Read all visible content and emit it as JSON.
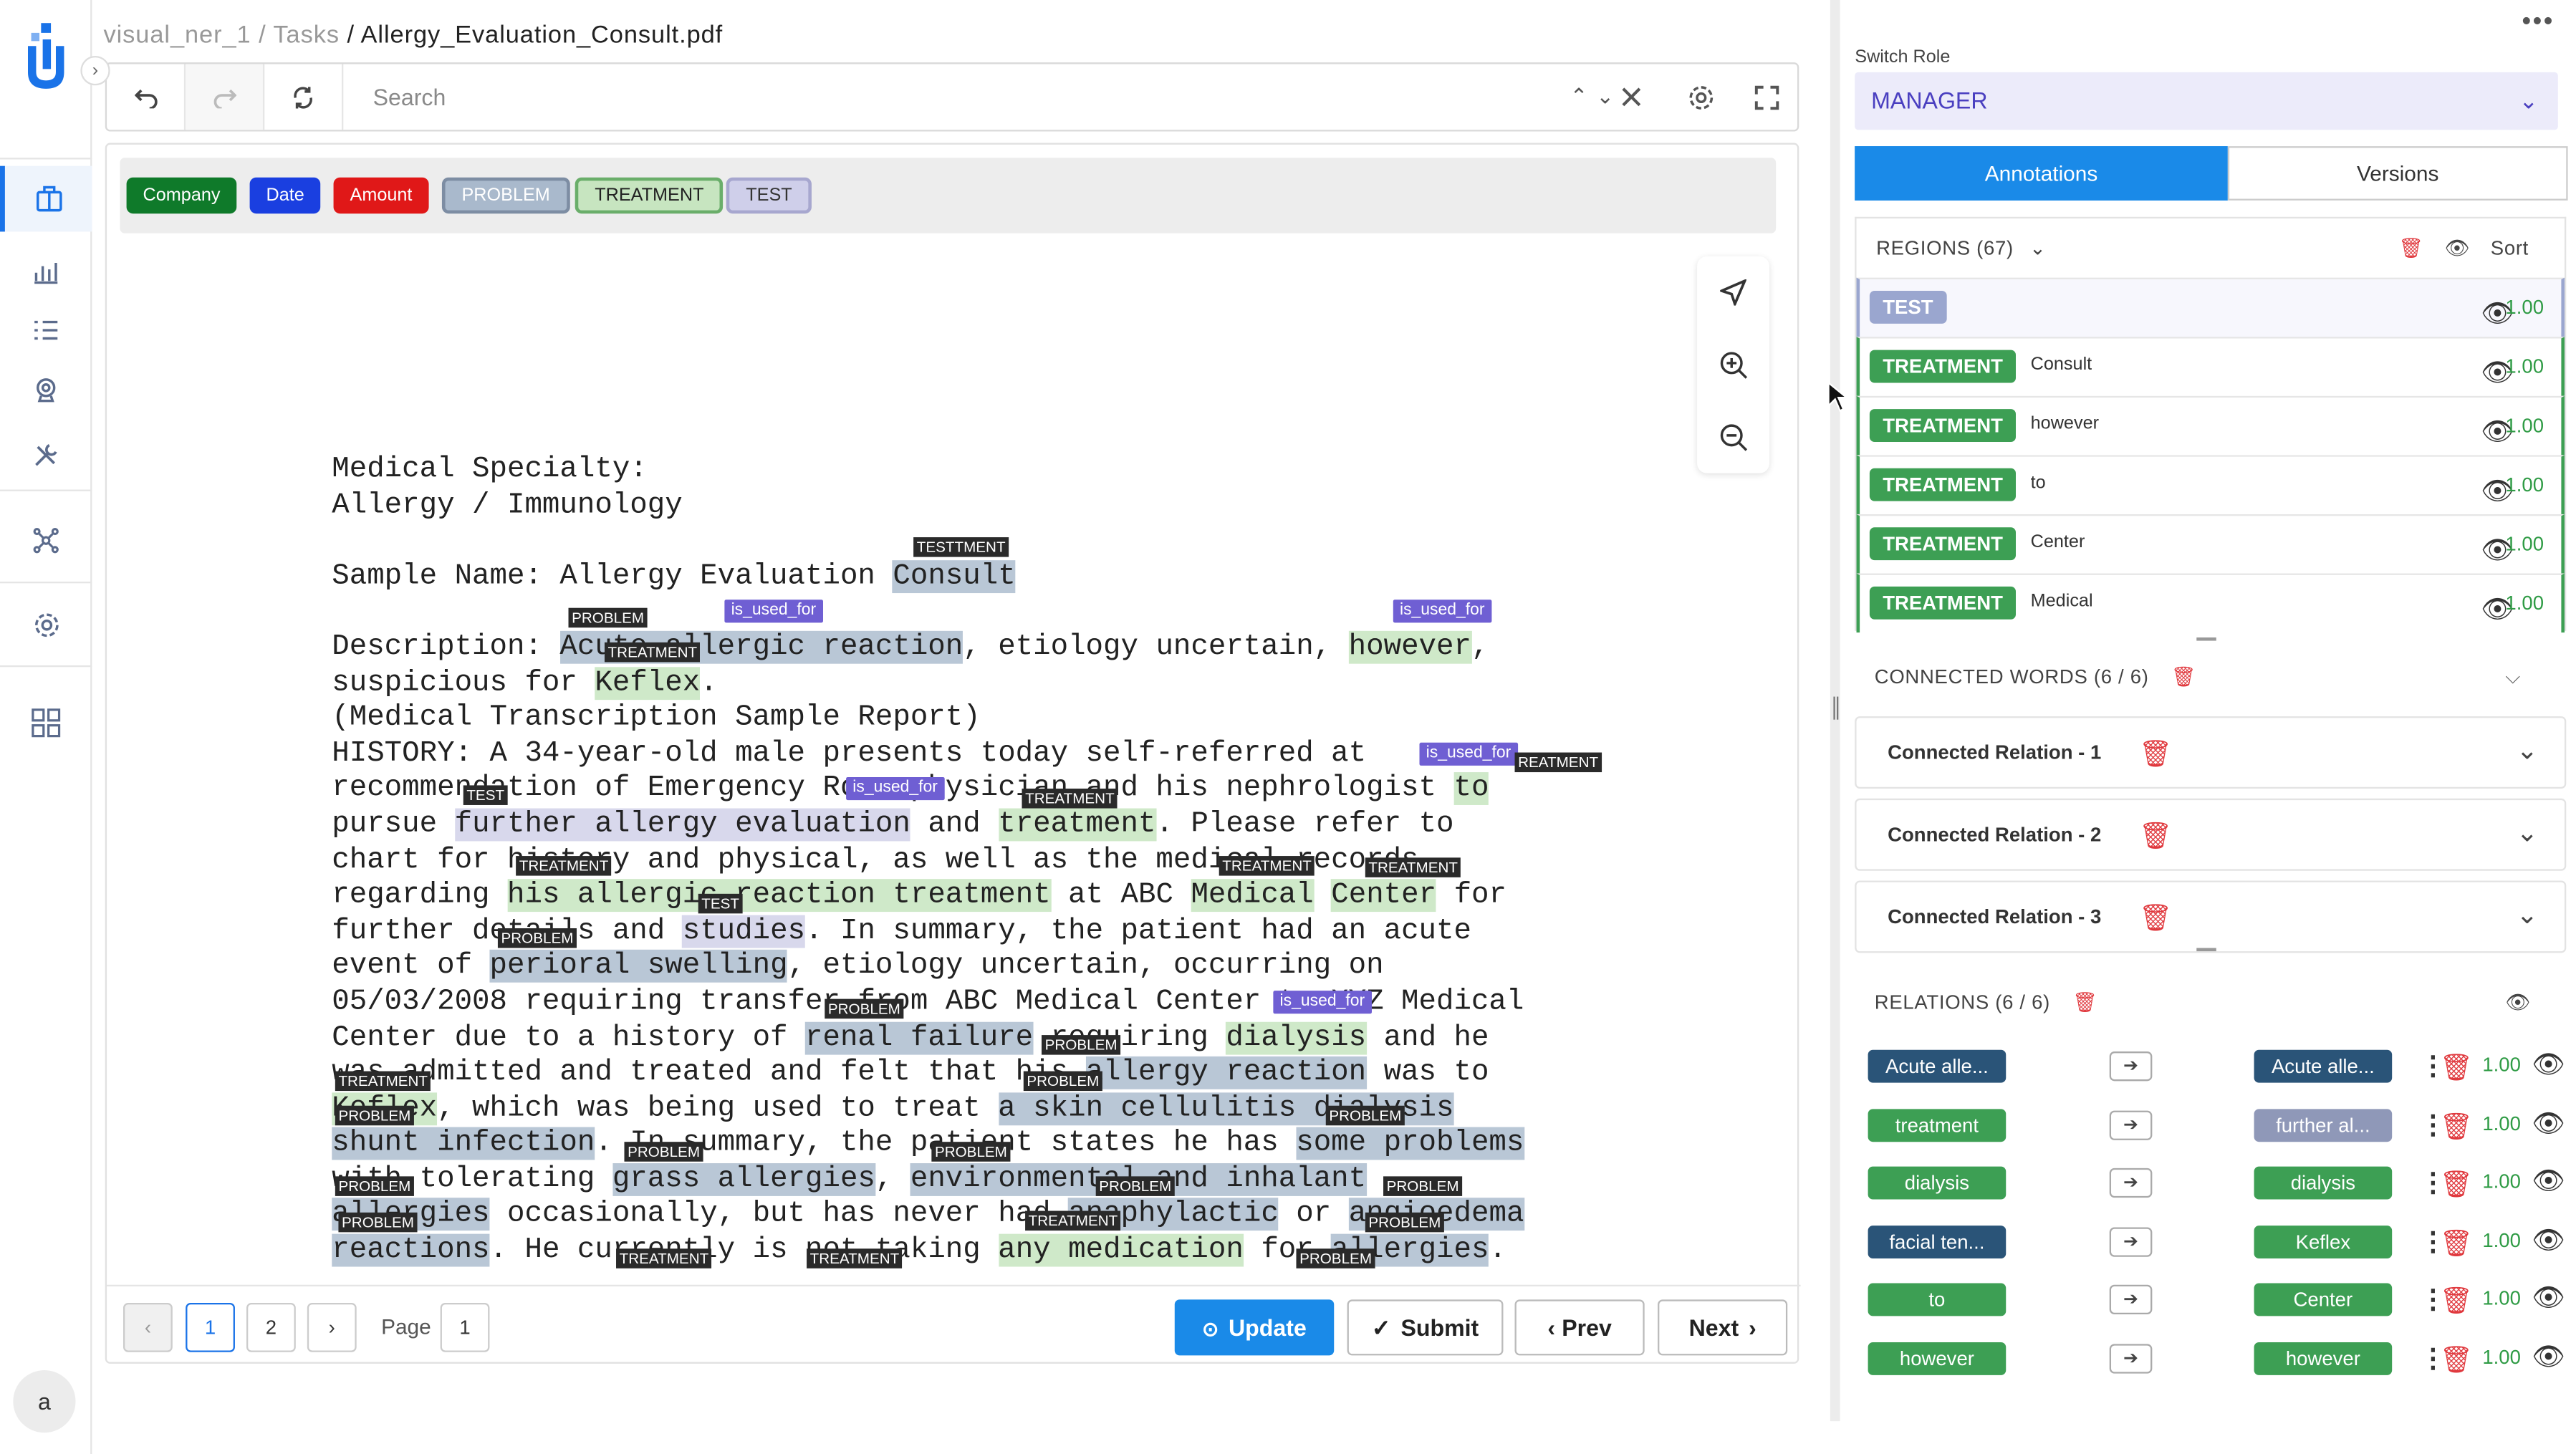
{
  "app": {
    "breadcrumb": {
      "project": "visual_ner_1",
      "sep1": "/",
      "section": "Tasks",
      "sep2": "/",
      "file": "Allergy_Evaluation_Consult.pdf"
    },
    "avatar_initial": "a"
  },
  "toolbar": {
    "search_placeholder": "Search"
  },
  "labels": [
    {
      "text": "Company",
      "bg": "#0f7a2a",
      "fg": "#ffffff"
    },
    {
      "text": "Date",
      "bg": "#1a3fe0",
      "fg": "#ffffff"
    },
    {
      "text": "Amount",
      "bg": "#e01818",
      "fg": "#ffffff"
    },
    {
      "text": "PROBLEM",
      "bg": "#a9b9cc",
      "fg": "#ffffff"
    },
    {
      "text": "TREATMENT",
      "bg": "#c7e5c0",
      "fg": "#222222"
    },
    {
      "text": "TEST",
      "bg": "#cfcfea",
      "fg": "#333333"
    }
  ],
  "doc": {
    "l1": "Medical Specialty:",
    "l2": "Allergy / Immunology",
    "l4a": "Sample Name: Allergy Evaluation ",
    "l4b": "Consult",
    "l6a": "Description: ",
    "l6b": "Acute allergic reaction",
    "l6c": ", etiology uncertain, ",
    "l6d": "however",
    "l6e": ",",
    "l7a": "suspicious for ",
    "l7b": "Keflex",
    "l7c": ".",
    "l8": "(Medical Transcription Sample Report)",
    "l9": "HISTORY: A 34-year-old male presents today self-referred at",
    "l10a": "recommendation of Emergency Room physician and his nephrologist ",
    "l10b": "to",
    "l11a": "pursue ",
    "l11b": "further allergy evaluation",
    "l11c": " and ",
    "l11d": "treatment",
    "l11e": ". Please refer to",
    "l12": "chart for history and physical, as well as the medical records",
    "l13a": "regarding ",
    "l13b": "his allergic reaction treatment",
    "l13c": " at ABC ",
    "l13d": "Medical",
    "l13e": " ",
    "l13f": "Center",
    "l13g": " for",
    "l14a": "further details and ",
    "l14b": "studies",
    "l14c": ". In summary, the patient had an acute",
    "l15a": "event of ",
    "l15b": "perioral swelling",
    "l15c": ", etiology uncertain, occurring on",
    "l16": "05/03/2008 requiring transfer from ABC Medical Center to XYZ Medical",
    "l17a": "Center due to a history of ",
    "l17b": "renal failure",
    "l17c": " requiring ",
    "l17d": "dialysis",
    "l17e": " and he",
    "l18a": "was admitted and treated and felt that his ",
    "l18b": "allergy reaction",
    "l18c": " was to",
    "l19a": "Keflex",
    "l19b": ", which was being used to treat ",
    "l19c": "a skin cellulitis dialysis",
    "l20a": "shunt infection",
    "l20b": ". In summary, the patient states he has ",
    "l20c": "some problems",
    "l21a": "with tolerating ",
    "l21b": "grass allergies",
    "l21c": ", ",
    "l21d": "environmental and inhalant",
    "l22a": "allergies",
    "l22b": " occasionally, but has never had ",
    "l22c": "anaphylactic",
    "l22d": " or ",
    "l22e": "angioedema",
    "l23a": "reactions",
    "l23b": ". He currently is not taking ",
    "l23c": "any medication",
    "l23d": " for ",
    "l23e": "allergies",
    "l23f": "."
  },
  "doc_tags": {
    "test_tment": "TESTTMENT",
    "problem": "PROBLEM",
    "treatment": "TREATMENT",
    "test": "TEST",
    "reatment": "REATMENT",
    "is_used_for": "is_used_for"
  },
  "pager": {
    "prev_page": "‹",
    "page1": "1",
    "page2": "2",
    "next_page": "›",
    "page_label": "Page",
    "page_value": "1",
    "update": "Update",
    "submit": "Submit",
    "prev": "Prev",
    "next": "Next"
  },
  "right": {
    "switch_role_label": "Switch Role",
    "role_value": "MANAGER",
    "tab_annotations": "Annotations",
    "tab_versions": "Versions",
    "regions_title": "REGIONS (67)",
    "sort_label": "Sort",
    "regions": [
      {
        "label": "TEST",
        "text": "",
        "score": "1.00",
        "color": "#9aa6cf"
      },
      {
        "label": "TREATMENT",
        "text": "Consult",
        "score": "1.00",
        "color": "#3d9f54"
      },
      {
        "label": "TREATMENT",
        "text": "however",
        "score": "1.00",
        "color": "#3d9f54"
      },
      {
        "label": "TREATMENT",
        "text": "to",
        "score": "1.00",
        "color": "#3d9f54"
      },
      {
        "label": "TREATMENT",
        "text": "Center",
        "score": "1.00",
        "color": "#3d9f54"
      },
      {
        "label": "TREATMENT",
        "text": "Medical",
        "score": "1.00",
        "color": "#3d9f54"
      }
    ],
    "connected_title": "CONNECTED WORDS (6 / 6)",
    "connected": [
      "Connected Relation - 1",
      "Connected Relation - 2",
      "Connected Relation - 3"
    ],
    "relations_title": "RELATIONS (6 / 6)",
    "relations": [
      {
        "from": "Acute alle...",
        "from_color": "#2a5478",
        "to": "Acute alle...",
        "to_color": "#2a5478",
        "score": "1.00"
      },
      {
        "from": "treatment",
        "from_color": "#3d9f54",
        "to": "further al...",
        "to_color": "#8f98b8",
        "score": "1.00"
      },
      {
        "from": "dialysis",
        "from_color": "#3d9f54",
        "to": "dialysis",
        "to_color": "#3d9f54",
        "score": "1.00"
      },
      {
        "from": "facial ten...",
        "from_color": "#2a5478",
        "to": "Keflex",
        "to_color": "#3d9f54",
        "score": "1.00"
      },
      {
        "from": "to",
        "from_color": "#3d9f54",
        "to": "Center",
        "to_color": "#3d9f54",
        "score": "1.00"
      },
      {
        "from": "however",
        "from_color": "#3d9f54",
        "to": "however",
        "to_color": "#3d9f54",
        "score": "1.00"
      }
    ]
  }
}
